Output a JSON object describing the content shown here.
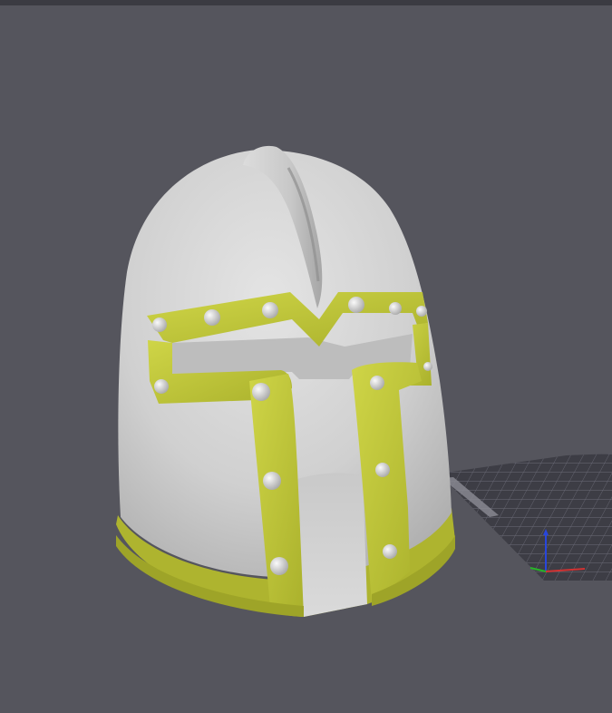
{
  "viewer": {
    "background_color": "#55555d",
    "top_strip_color": "#3b3b42",
    "model": {
      "name": "",
      "shell_color": "#d2d2d2",
      "trim_color": "#c4ca3c",
      "rivet_color": "#e6e6e6"
    },
    "build_plate": {
      "grid_color": "#6c6c78",
      "plate_color": "#3d3d45"
    },
    "axes_gizmo": {
      "x_color": "#d23232",
      "y_color": "#28b428",
      "z_color": "#2846dc",
      "icon": "axes-gizmo-icon"
    }
  }
}
